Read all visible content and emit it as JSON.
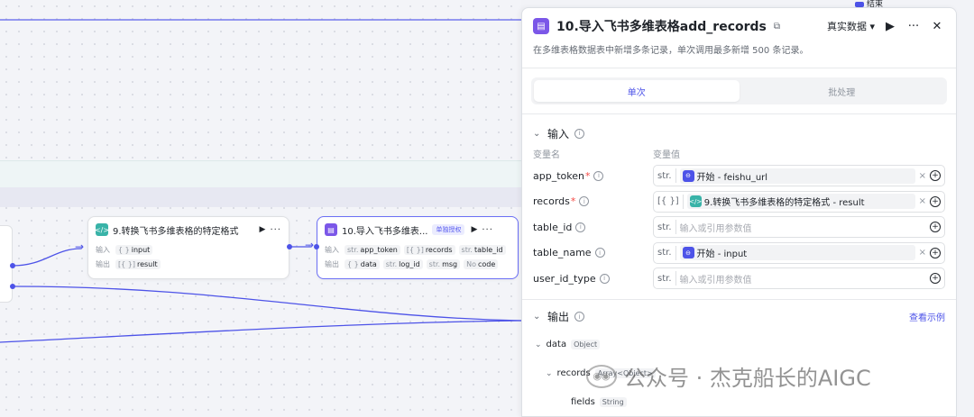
{
  "canvas": {
    "node9": {
      "title": "9.转换飞书多维表格的特定格式",
      "input_label": "输入",
      "output_label": "输出",
      "inputs": [
        {
          "type": "{ }",
          "name": "input"
        }
      ],
      "outputs": [
        {
          "type": "[{ }]",
          "name": "result"
        }
      ]
    },
    "node10": {
      "title": "10.导入飞书多维表...",
      "auth_pill": "单独授权",
      "input_label": "输入",
      "output_label": "输出",
      "inputs": [
        {
          "type": "str.",
          "name": "app_token"
        },
        {
          "type": "[{ }]",
          "name": "records"
        },
        {
          "type": "str.",
          "name": "table_id"
        }
      ],
      "outputs": [
        {
          "type": "{ }",
          "name": "data"
        },
        {
          "type": "str.",
          "name": "log_id"
        },
        {
          "type": "str.",
          "name": "msg"
        },
        {
          "type": "No",
          "name": "code"
        }
      ]
    },
    "top_right_label": "结束"
  },
  "panel": {
    "title": "10.导入飞书多维表格add_records",
    "mode": "真实数据",
    "description": "在多维表格数据表中新增多条记录，单次调用最多新增 500 条记录。",
    "tabs": [
      {
        "label": "单次",
        "active": true
      },
      {
        "label": "批处理",
        "active": false
      }
    ],
    "input_section": {
      "title": "输入",
      "col_name": "变量名",
      "col_value": "变量值",
      "rows": [
        {
          "name": "app_token",
          "required": true,
          "type": "str.",
          "ref": "开始 - feishu_url",
          "ref_icon": "blue"
        },
        {
          "name": "records",
          "required": true,
          "type": "[{ }]",
          "ref": "9.转换飞书多维表格的特定格式 - result",
          "ref_icon": "teal"
        },
        {
          "name": "table_id",
          "required": false,
          "type": "str.",
          "placeholder": "输入或引用参数值"
        },
        {
          "name": "table_name",
          "required": false,
          "type": "str.",
          "ref": "开始 - input",
          "ref_icon": "blue"
        },
        {
          "name": "user_id_type",
          "required": false,
          "type": "str.",
          "placeholder": "输入或引用参数值"
        }
      ]
    },
    "output_section": {
      "title": "输出",
      "example_link": "查看示例",
      "tree": [
        {
          "name": "data",
          "type": "Object"
        },
        {
          "name": "records",
          "type": "Array<Object>"
        },
        {
          "name": "fields",
          "type": "String"
        }
      ]
    }
  },
  "watermark": {
    "text": "公众号 · 杰克船长的AIGC"
  },
  "colors": {
    "accent": "#4d53e8",
    "node_teal": "#39b3a8",
    "node_purple": "#7b57e8",
    "required": "#f54a45"
  }
}
